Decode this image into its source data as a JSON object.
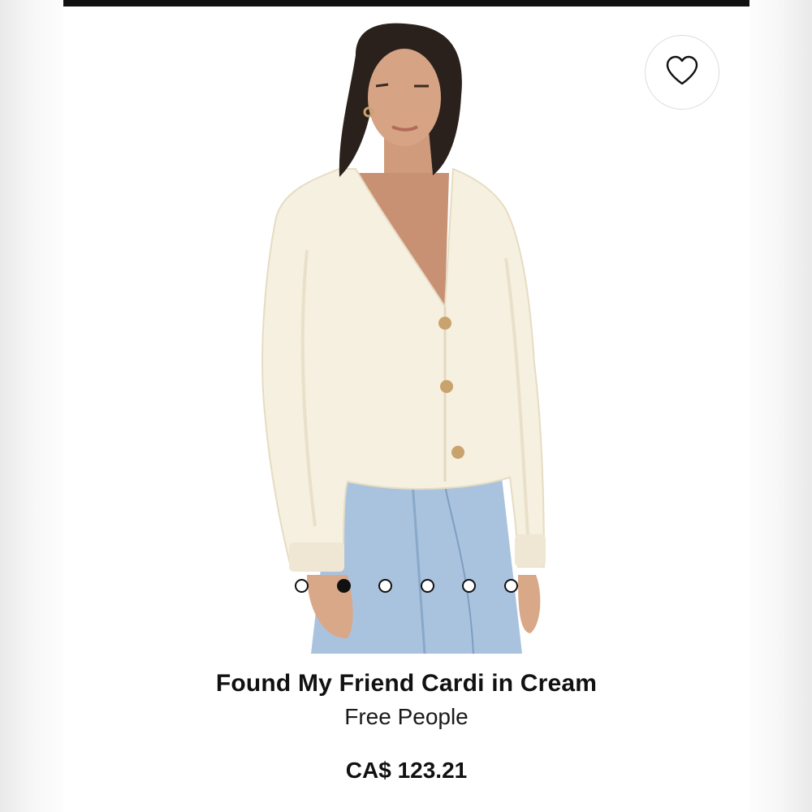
{
  "product": {
    "title": "Found My Friend Cardi in Cream",
    "brand": "Free People",
    "price": "CA$ 123.21"
  },
  "wishlist": {
    "icon": "heart-outline-icon"
  },
  "carousel": {
    "total_images": 6,
    "active_index": 1
  },
  "colors": {
    "top_bar": "#111111",
    "background": "#ffffff",
    "text": "#111111"
  }
}
